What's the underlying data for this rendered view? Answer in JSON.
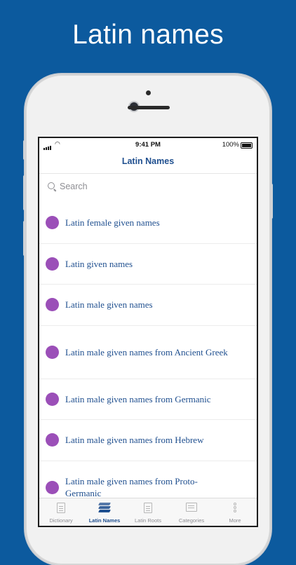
{
  "headline": "Latin names",
  "status_bar": {
    "time": "9:41 PM",
    "battery": "100%"
  },
  "nav": {
    "title": "Latin Names"
  },
  "search": {
    "placeholder": "Search"
  },
  "list": {
    "items": [
      {
        "label": "Latin female given names"
      },
      {
        "label": "Latin given names"
      },
      {
        "label": "Latin male given names"
      },
      {
        "label": "Latin male given names from Ancient Greek"
      },
      {
        "label": "Latin male given names from Germanic"
      },
      {
        "label": "Latin male given names from Hebrew"
      },
      {
        "label": "Latin male given names from Proto-Germanic"
      }
    ],
    "dot_color": "#9b4fb8"
  },
  "tabbar": {
    "tabs": [
      {
        "label": "Dictionary",
        "icon": "dictionary-icon"
      },
      {
        "label": "Latin Names",
        "icon": "layers-icon",
        "active": true
      },
      {
        "label": "Latin Roots",
        "icon": "document-icon"
      },
      {
        "label": "Categories",
        "icon": "categories-icon"
      },
      {
        "label": "More",
        "icon": "more-icon"
      }
    ]
  },
  "colors": {
    "background": "#0c5a9e",
    "accent": "#1f4f8f",
    "dot": "#9b4fb8"
  }
}
